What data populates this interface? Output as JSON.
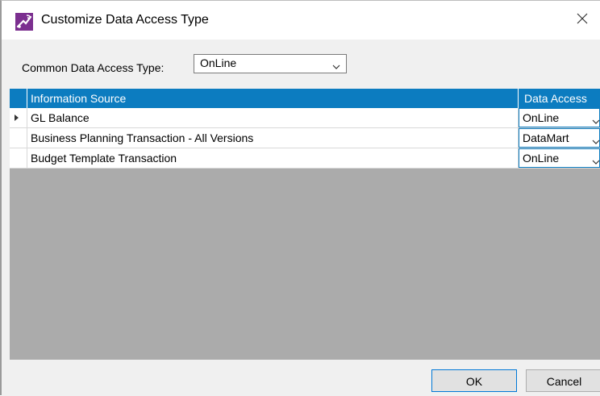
{
  "window": {
    "title": "Customize Data Access Type"
  },
  "common": {
    "label": "Common Data Access Type:",
    "value": "OnLine"
  },
  "grid": {
    "columns": [
      "Information Source",
      "Data Access"
    ],
    "rows": [
      {
        "source": "GL Balance",
        "access": "OnLine",
        "current": true
      },
      {
        "source": "Business Planning Transaction - All Versions",
        "access": "DataMart",
        "current": false
      },
      {
        "source": "Budget Template Transaction",
        "access": "OnLine",
        "current": false
      }
    ]
  },
  "buttons": {
    "ok": "OK",
    "cancel": "Cancel"
  },
  "icons": {
    "app": "app-logo-icon",
    "close": "close-icon",
    "dropdown": "chevron-down-icon",
    "row_pointer": "row-pointer-icon"
  },
  "colors": {
    "header_bg": "#0c7cc0",
    "grid_bg": "#ababab",
    "icon_purple": "#7b2f8f",
    "ok_border": "#0078d7"
  }
}
